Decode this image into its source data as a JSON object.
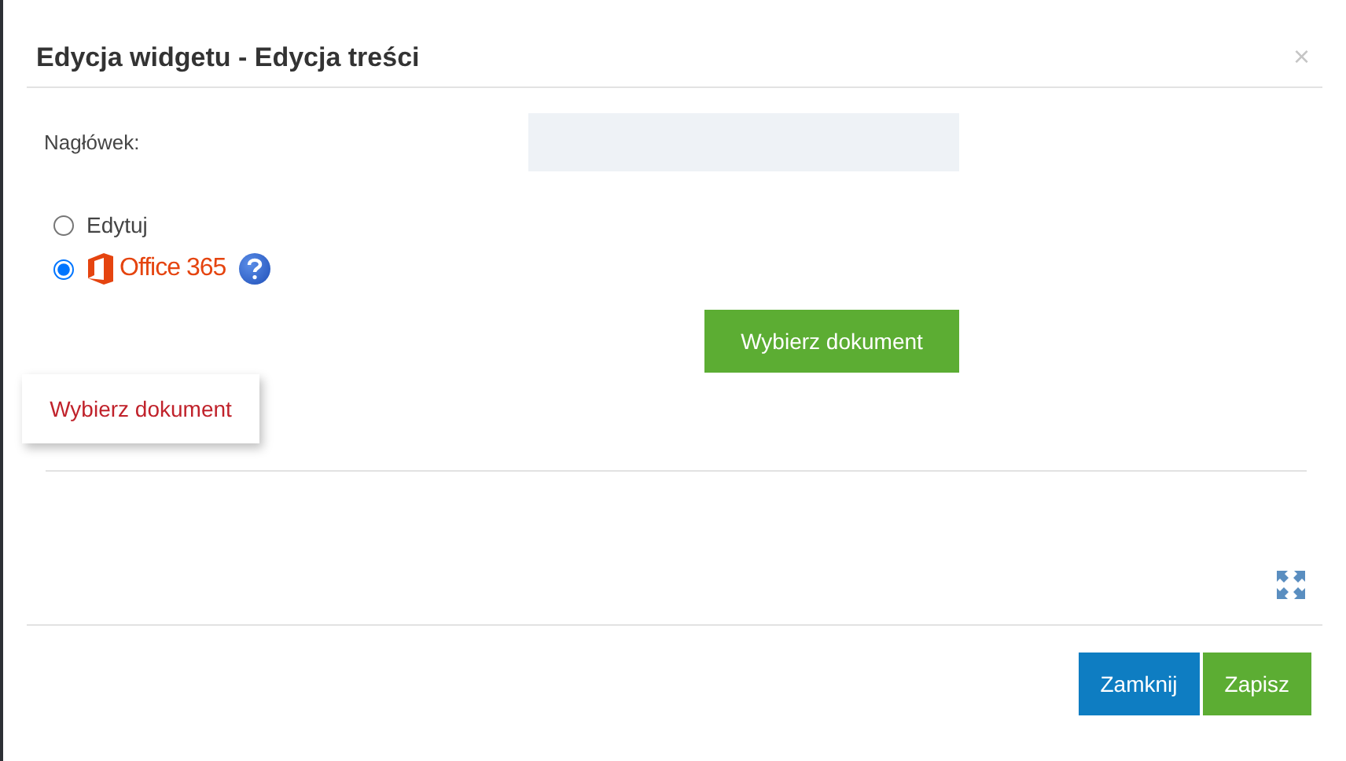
{
  "dialog": {
    "title": "Edycja widgetu - Edycja treści",
    "close": "×"
  },
  "header_field": {
    "label": "Nagłówek:"
  },
  "source_options": [
    {
      "kind": "text",
      "label": "Edytuj",
      "selected": false
    },
    {
      "kind": "office",
      "label": "Office 365",
      "selected": true
    }
  ],
  "choose_button": "Wybierz dokument",
  "document_link": "Wybierz dokument",
  "footer_buttons": [
    {
      "label": "Zamknij",
      "kind": "secondary"
    },
    {
      "label": "Zapisz",
      "kind": "primary"
    }
  ]
}
